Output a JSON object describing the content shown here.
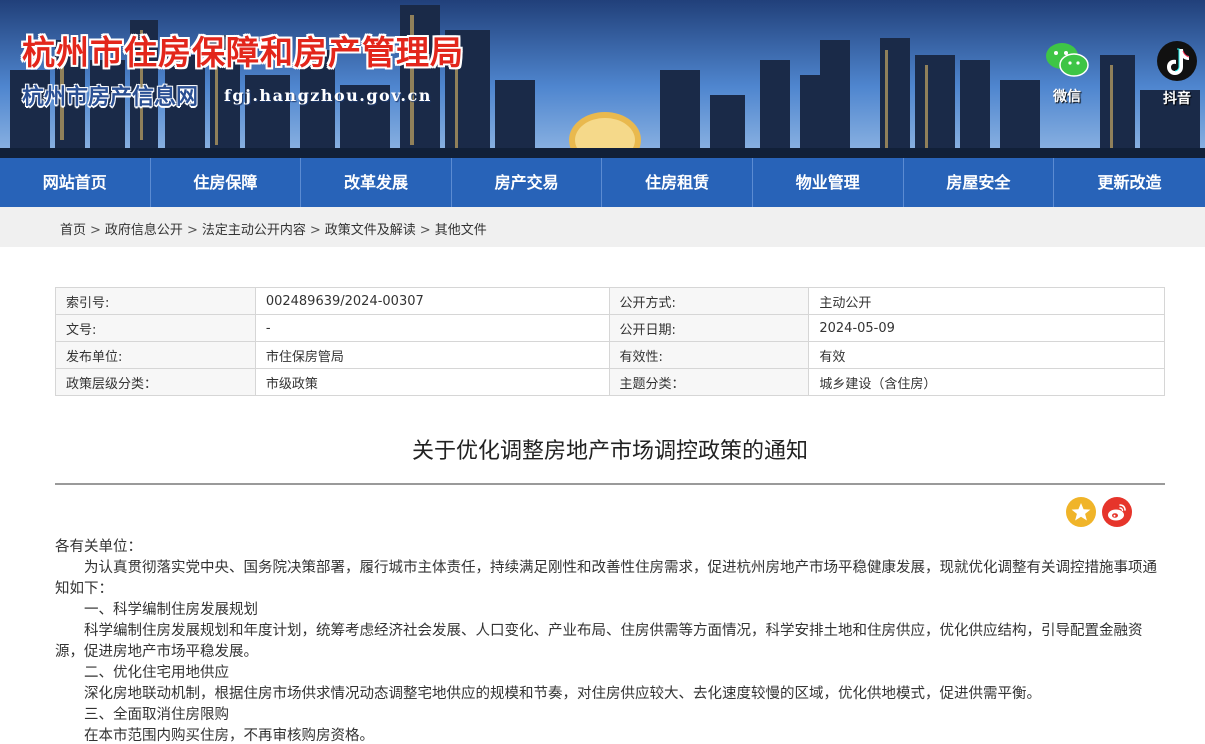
{
  "banner": {
    "title": "杭州市住房保障和房产管理局",
    "subtitle": "杭州市房产信息网",
    "url": "fgj.hangzhou.gov.cn",
    "social": [
      {
        "icon": "wechat-icon",
        "label": "微信"
      },
      {
        "icon": "tiktok-icon",
        "label": "抖音"
      }
    ]
  },
  "nav": [
    {
      "label": "网站首页"
    },
    {
      "label": "住房保障"
    },
    {
      "label": "改革发展"
    },
    {
      "label": "房产交易"
    },
    {
      "label": "住房租赁"
    },
    {
      "label": "物业管理"
    },
    {
      "label": "房屋安全"
    },
    {
      "label": "更新改造"
    }
  ],
  "breadcrumb": [
    "首页",
    "政府信息公开",
    "法定主动公开内容",
    "政策文件及解读",
    "其他文件"
  ],
  "breadcrumb_separator": ">",
  "info": [
    [
      "索引号:",
      "002489639/2024-00307",
      "公开方式:",
      "主动公开"
    ],
    [
      "文号:",
      "-",
      "公开日期:",
      "2024-05-09"
    ],
    [
      "发布单位:",
      "市住保房管局",
      "有效性:",
      "有效"
    ],
    [
      "政策层级分类：",
      "市级政策",
      "主题分类：",
      "城乡建设（含住房）"
    ]
  ],
  "document": {
    "title": "关于优化调整房地产市场调控政策的通知",
    "share_icons": [
      "star-share-icon",
      "weibo-icon"
    ],
    "salutation": "各有关单位：",
    "paragraphs": [
      "为认真贯彻落实党中央、国务院决策部署，履行城市主体责任，持续满足刚性和改善性住房需求，促进杭州房地产市场平稳健康发展，现就优化调整有关调控措施事项通知如下：",
      "一、科学编制住房发展规划",
      "科学编制住房发展规划和年度计划，统筹考虑经济社会发展、人口变化、产业布局、住房供需等方面情况，科学安排土地和住房供应，优化供应结构，引导配置金融资源，促进房地产市场平稳发展。",
      "二、优化住宅用地供应",
      "深化房地联动机制，根据住房市场供求情况动态调整宅地供应的规模和节奏，对住房供应较大、去化速度较慢的区域，优化供地模式，促进供需平衡。",
      "三、全面取消住房限购",
      "在本市范围内购买住房，不再审核购房资格。"
    ]
  },
  "colors": {
    "nav_bg": "#2863b8",
    "title_red": "#e3261b",
    "crumb_bg": "#f0f0f0"
  }
}
